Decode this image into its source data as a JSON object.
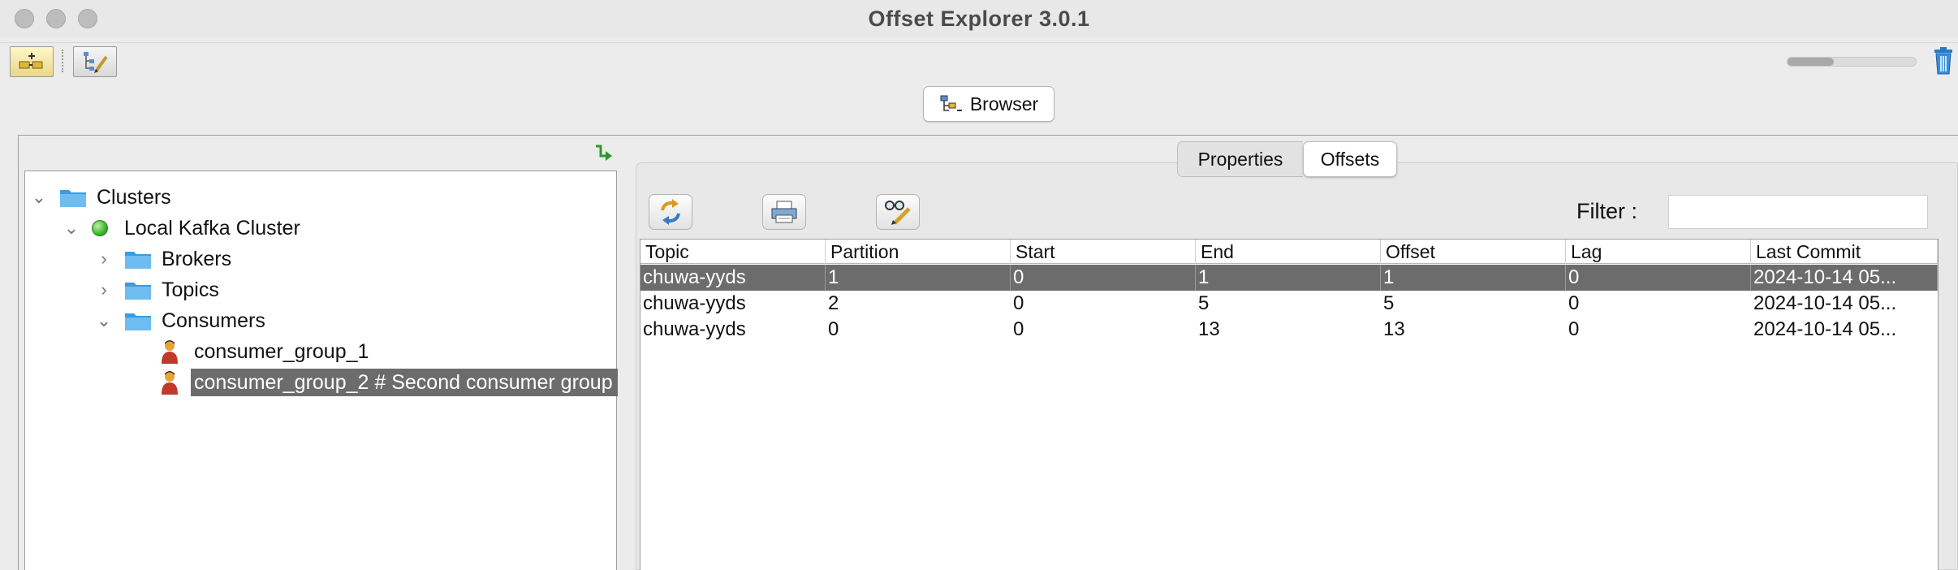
{
  "window": {
    "title": "Offset Explorer  3.0.1"
  },
  "toolbar": {
    "buttons": [
      {
        "icon": "add-connection-icon"
      },
      {
        "icon": "edit-tree-icon"
      }
    ],
    "progress": 0.36,
    "trash_icon": "trash-icon"
  },
  "browser_tab": {
    "label": "Browser",
    "icon": "browser-icon"
  },
  "tree": {
    "root": "Clusters",
    "cluster": "Local Kafka Cluster",
    "brokers": "Brokers",
    "topics": "Topics",
    "consumers": "Consumers",
    "groups": [
      {
        "label": "consumer_group_1"
      },
      {
        "label": "consumer_group_2 # Second consumer group"
      }
    ]
  },
  "tabs": {
    "properties": "Properties",
    "offsets": "Offsets"
  },
  "filter": {
    "label": "Filter :",
    "value": ""
  },
  "table": {
    "columns": [
      "Topic",
      "Partition",
      "Start",
      "End",
      "Offset",
      "Lag",
      "Last Commit"
    ],
    "rows": [
      [
        "chuwa-yyds",
        "1",
        "0",
        "1",
        "1",
        "0",
        "2024-10-14 05..."
      ],
      [
        "chuwa-yyds",
        "2",
        "0",
        "5",
        "5",
        "0",
        "2024-10-14 05..."
      ],
      [
        "chuwa-yyds",
        "0",
        "0",
        "13",
        "13",
        "0",
        "2024-10-14 05..."
      ]
    ]
  },
  "colors": {
    "selection": "#6c6c6c",
    "folder": "#4aa8e6"
  }
}
